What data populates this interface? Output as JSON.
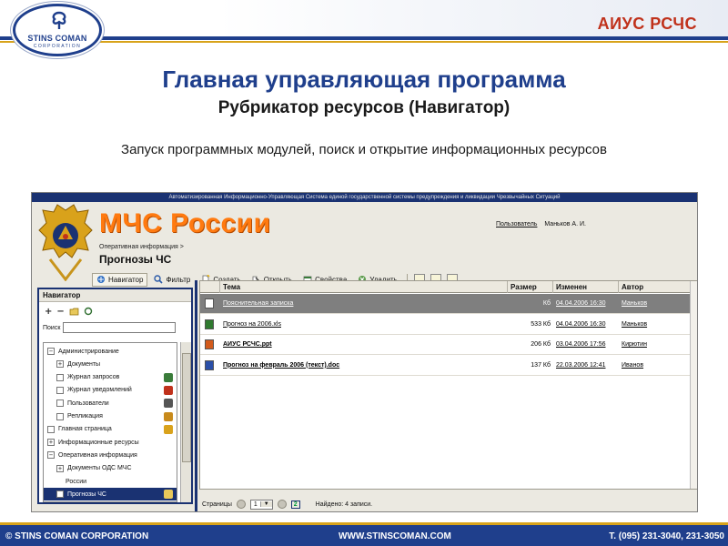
{
  "slide": {
    "company_name": "STINS COMAN",
    "company_sub": "CORPORATION",
    "brand": "АИУС РСЧС",
    "title": "Главная управляющая программа",
    "subtitle": "Рубрикатор ресурсов (Навигатор)",
    "description": "Запуск программных модулей, поиск и открытие информационных ресурсов",
    "accent_color": "#1f3f8c",
    "brand_color": "#c0311b",
    "stripe_color": "#d8a31a"
  },
  "app": {
    "banner": "Автоматизированная Информационно-Управляющая Система единой государственной системы предупреждения и ликвидации Чрезвычайных Ситуаций",
    "logo_text": "МЧС России",
    "section_path": "Оперативная информация >",
    "section_title": "Прогнозы ЧС",
    "user_label": "Пользователь",
    "user_name": "Маньков  А. И.",
    "toolbar": [
      {
        "label": "Навигатор",
        "icon": "navigator-icon",
        "active": true
      },
      {
        "label": "Фильтр",
        "icon": "filter-icon"
      },
      {
        "label": "Создать",
        "icon": "create-icon"
      },
      {
        "label": "Открыть",
        "icon": "open-icon"
      },
      {
        "label": "Свойства",
        "icon": "properties-icon"
      },
      {
        "label": "Удалить",
        "icon": "delete-icon"
      }
    ],
    "navigator": {
      "title": "Навигатор",
      "tools": [
        "+",
        "−"
      ],
      "search_label": "Поиск",
      "search_value": "",
      "tree": [
        {
          "label": "Администрирование",
          "box": "−",
          "indent": 0
        },
        {
          "label": "Документы",
          "box": "+",
          "indent": 1
        },
        {
          "label": "Журнал запросов",
          "box": "",
          "indent": 1,
          "icon": "journal-icon"
        },
        {
          "label": "Журнал уведомлений",
          "box": "",
          "indent": 1,
          "icon": "notifications-icon"
        },
        {
          "label": "Пользователи",
          "box": "",
          "indent": 1,
          "icon": "users-icon"
        },
        {
          "label": "Репликация",
          "box": "",
          "indent": 1,
          "icon": "replication-icon"
        },
        {
          "label": "Главная страница",
          "box": "",
          "indent": 0,
          "icon": "home-icon"
        },
        {
          "label": "Информационные ресурсы",
          "box": "+",
          "indent": 0
        },
        {
          "label": "Оперативная информация",
          "box": "−",
          "indent": 0
        },
        {
          "label": "Документы ОДС МЧС",
          "box": "+",
          "indent": 1
        },
        {
          "label": "России",
          "box": "",
          "indent": 2,
          "nobox": true
        },
        {
          "label": "Прогнозы ЧС",
          "box": "",
          "indent": 1,
          "selected": true,
          "icon": "folder-icon"
        }
      ]
    },
    "grid": {
      "columns": [
        "Тема",
        "Размер",
        "Изменен",
        "Автор"
      ],
      "rows": [
        {
          "icon": "doc-icon",
          "theme": "Пояснительная записка",
          "size": "Кб",
          "modified": "04.04.2006 16:30",
          "author": "Маньков",
          "highlight": true
        },
        {
          "icon": "xls-icon",
          "theme": "Прогноз на 2006.xls",
          "size": "533 Кб",
          "modified": "04.04.2006 16:30",
          "author": "Маньков"
        },
        {
          "icon": "ppt-icon",
          "theme": "АИУС РСЧС.ppt",
          "size": "206 Кб",
          "modified": "03.04.2006 17:56",
          "author": "Кирютин",
          "bold": true
        },
        {
          "icon": "word-icon",
          "theme": "Прогноз на февраль 2006 (текст).doc",
          "size": "137 Кб",
          "modified": "22.03.2006 12:41",
          "author": "Иванов",
          "bold": true
        }
      ],
      "pages_label": "Страницы",
      "page_value": "1",
      "page_count": "2",
      "found": "Найдено: 4 записи."
    }
  },
  "footer": {
    "copyright": "© STINS COMAN CORPORATION",
    "website": "WWW.STINSCOMAN.COM",
    "phone": "T. (095) 231-3040, 231-3050"
  }
}
